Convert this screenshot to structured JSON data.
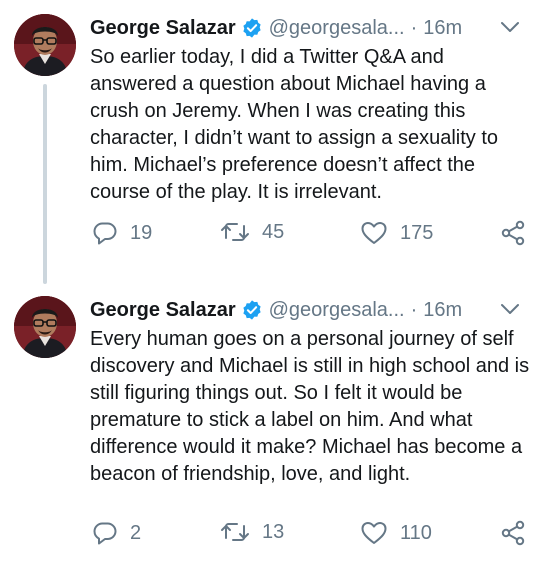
{
  "tweets": [
    {
      "author": {
        "name": "George Salazar",
        "handle": "@georgesala...",
        "verified": true
      },
      "time": "16m",
      "separator": "·",
      "text": "So earlier today, I did a Twitter Q&A and answered a question about Michael having a crush on Jeremy. When I was creating this character, I didn’t want to assign a sexuality to him. Michael’s preference doesn’t affect the course of the play. It is irrelevant.",
      "replies": "19",
      "retweets": "45",
      "likes": "175"
    },
    {
      "author": {
        "name": "George Salazar",
        "handle": "@georgesala...",
        "verified": true
      },
      "time": "16m",
      "separator": "·",
      "text": "Every human goes on a personal journey of self discovery and Michael is still in high school and is still figuring things out. So I felt it would be premature to stick a label on him. And what difference would it make? Michael has become a beacon of friendship, love, and light.",
      "replies": "2",
      "retweets": "13",
      "likes": "110"
    }
  ],
  "colors": {
    "verified": "#1da1f2",
    "secondary_text": "#657786",
    "primary_text": "#14171a",
    "thread_line": "#ccd6dd"
  },
  "icons": {
    "reply": "reply-icon",
    "retweet": "retweet-icon",
    "like": "heart-icon",
    "share": "share-icon",
    "more": "chevron-down-icon",
    "verified": "verified-badge-icon"
  }
}
